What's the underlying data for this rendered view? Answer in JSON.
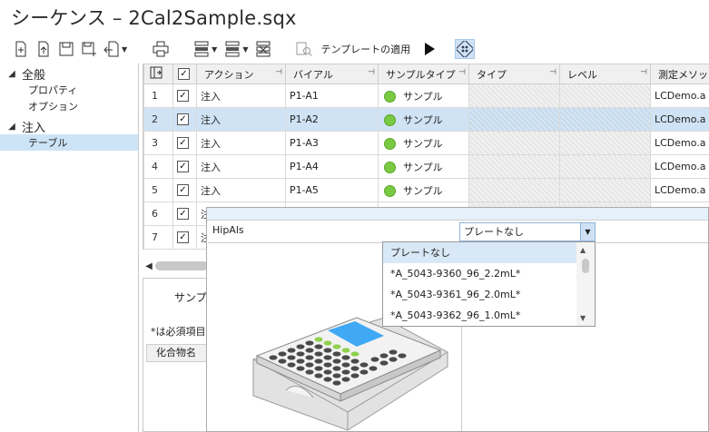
{
  "window": {
    "title": "シーケンス – 2Cal2Sample.sqx"
  },
  "toolbar": {
    "apply_template_label": "テンプレートの適用"
  },
  "tree": {
    "groups": [
      {
        "label": "全般",
        "children": [
          "プロパティ",
          "オプション"
        ]
      },
      {
        "label": "注入",
        "children": [
          "テーブル"
        ]
      }
    ]
  },
  "grid": {
    "headers": [
      "アクション",
      "バイアル",
      "サンプルタイプ",
      "タイプ",
      "レベル",
      "測定メソッド"
    ],
    "rows": [
      {
        "num": "1",
        "action": "注入",
        "vial": "P1-A1",
        "sample_type": "サンプル",
        "method": "LCDemo.a"
      },
      {
        "num": "2",
        "action": "注入",
        "vial": "P1-A2",
        "sample_type": "サンプル",
        "method": "LCDemo.a"
      },
      {
        "num": "3",
        "action": "注入",
        "vial": "P1-A3",
        "sample_type": "サンプル",
        "method": "LCDemo.a"
      },
      {
        "num": "4",
        "action": "注入",
        "vial": "P1-A4",
        "sample_type": "サンプル",
        "method": "LCDemo.a"
      },
      {
        "num": "5",
        "action": "注入",
        "vial": "P1-A5",
        "sample_type": "サンプル",
        "method": "LCDemo.a"
      },
      {
        "num": "6",
        "action": "注",
        "vial": "",
        "sample_type": "",
        "method": ""
      },
      {
        "num": "7",
        "action": "注",
        "vial": "",
        "sample_type": "",
        "method": ""
      }
    ]
  },
  "bottom_panel": {
    "tab_label": "サンプル",
    "required_note": "*は必須項目",
    "column_header": "化合物名"
  },
  "popup": {
    "device_label": "HipAls",
    "plate_select_value": "プレートなし",
    "options": [
      "プレートなし",
      "*A_5043-9360_96_2.2mL*",
      "*A_5043-9361_96_2.0mL*",
      "*A_5043-9362_96_1.0mL*"
    ]
  },
  "colors": {
    "selection": "#cfe3f5",
    "sample_dot": "#7ac943",
    "liquid": "#3fa9f5"
  }
}
